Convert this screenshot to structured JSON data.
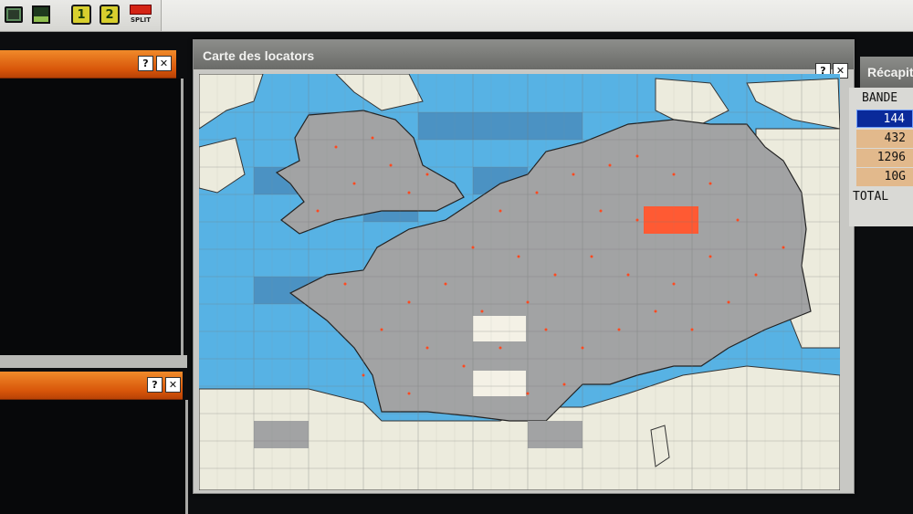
{
  "toolbar": {
    "icons": [
      "monitor-icon",
      "save-icon",
      "profile-1-icon",
      "profile-2-icon",
      "split-icon"
    ],
    "btn1_label": "1",
    "btn2_label": "2",
    "split_label": "SPLIT"
  },
  "left_panels": {
    "help_label": "?",
    "close_label": "✕"
  },
  "map_window": {
    "title": "Carte des locators",
    "help_label": "?",
    "close_label": "✕",
    "highlighted_square_color": "#ff5a33",
    "colors": {
      "sea": "#57b2e4",
      "sea_dark": "#4a8fc0",
      "land": "#ecebdd",
      "worked_square": "#a2a3a4",
      "qso_dot": "#ff4a20"
    }
  },
  "recap": {
    "title": "Récapitulatif",
    "header": "BANDE",
    "bands": [
      {
        "label": "144",
        "selected": true
      },
      {
        "label": "432",
        "selected": false
      },
      {
        "label": "1296",
        "selected": false
      },
      {
        "label": "10G",
        "selected": false
      }
    ],
    "total_label": "TOTAL",
    "colors": {
      "selected_bg": "#0a2a9a",
      "selected_fg": "#ffffff",
      "band_bg": "#e2b98c"
    }
  }
}
